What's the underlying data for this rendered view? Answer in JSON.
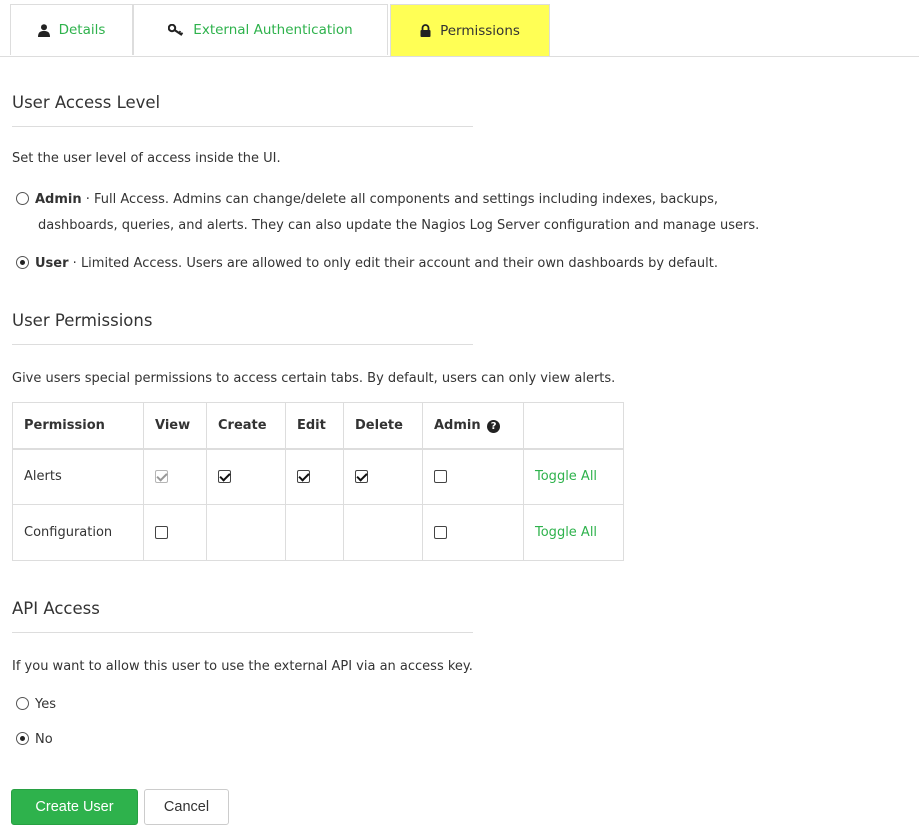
{
  "tabs": [
    {
      "label": "Details",
      "icon": "user-icon",
      "active": false
    },
    {
      "label": "External Authentication",
      "icon": "key-icon",
      "active": false
    },
    {
      "label": "Permissions",
      "icon": "lock-icon",
      "active": true
    }
  ],
  "access_level": {
    "heading": "User Access Level",
    "description": "Set the user level of access inside the UI.",
    "options": [
      {
        "name": "Admin",
        "sep": " · ",
        "text_line1": "Full Access. Admins can change/delete all components and settings including indexes, backups,",
        "text_line2": "dashboards, queries, and alerts. They can also update the Nagios Log Server configuration and manage users.",
        "checked": false
      },
      {
        "name": "User",
        "sep": " · ",
        "text_line1": "Limited Access. Users are allowed to only edit their account and their own dashboards by default.",
        "checked": true
      }
    ]
  },
  "permissions": {
    "heading": "User Permissions",
    "description": "Give users special permissions to access certain tabs. By default, users can only view alerts.",
    "columns": [
      "Permission",
      "View",
      "Create",
      "Edit",
      "Delete",
      "Admin"
    ],
    "rows": [
      {
        "name": "Alerts",
        "view": true,
        "view_disabled": true,
        "create": true,
        "edit": true,
        "delete": true,
        "admin": false,
        "action": "Toggle All"
      },
      {
        "name": "Configuration",
        "view": false,
        "admin": false,
        "action": "Toggle All"
      }
    ]
  },
  "api_access": {
    "heading": "API Access",
    "description": "If you want to allow this user to use the external API via an access key.",
    "options": [
      {
        "label": "Yes",
        "checked": false
      },
      {
        "label": "No",
        "checked": true
      }
    ]
  },
  "buttons": {
    "create": "Create User",
    "cancel": "Cancel"
  },
  "colors": {
    "accent": "#2eb24c",
    "active_tab": "#ffff55"
  }
}
